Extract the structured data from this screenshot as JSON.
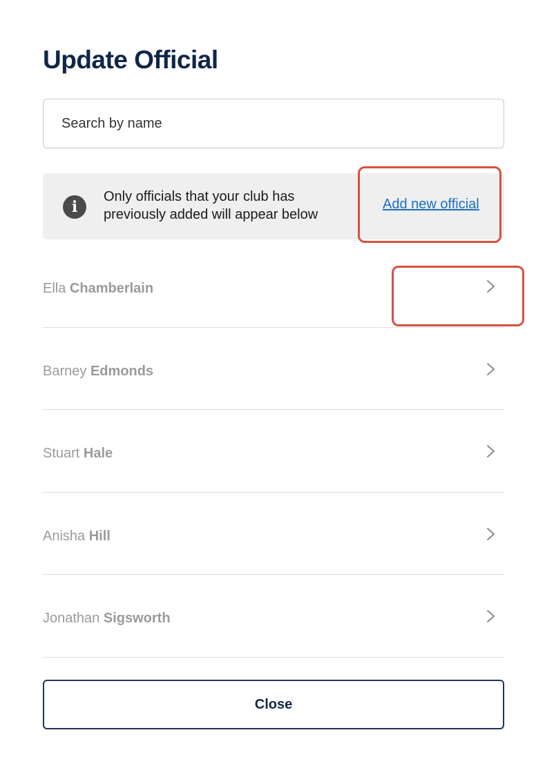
{
  "modal": {
    "title": "Update Official",
    "search": {
      "placeholder": "Search by name",
      "value": ""
    },
    "info": {
      "icon": "info-icon",
      "text": "Only officials that your club has previously added will appear below",
      "link_label": "Add new official"
    },
    "officials": [
      {
        "first": "Ella",
        "last": "Chamberlain"
      },
      {
        "first": "Barney",
        "last": "Edmonds"
      },
      {
        "first": "Stuart",
        "last": "Hale"
      },
      {
        "first": "Anisha",
        "last": "Hill"
      },
      {
        "first": "Jonathan",
        "last": "Sigsworth"
      }
    ],
    "close_label": "Close"
  },
  "colors": {
    "title": "#0f2747",
    "link": "#1a6fc4",
    "highlight": "#d9503f",
    "info_bg": "#efefef",
    "button_border": "#1e3556"
  }
}
